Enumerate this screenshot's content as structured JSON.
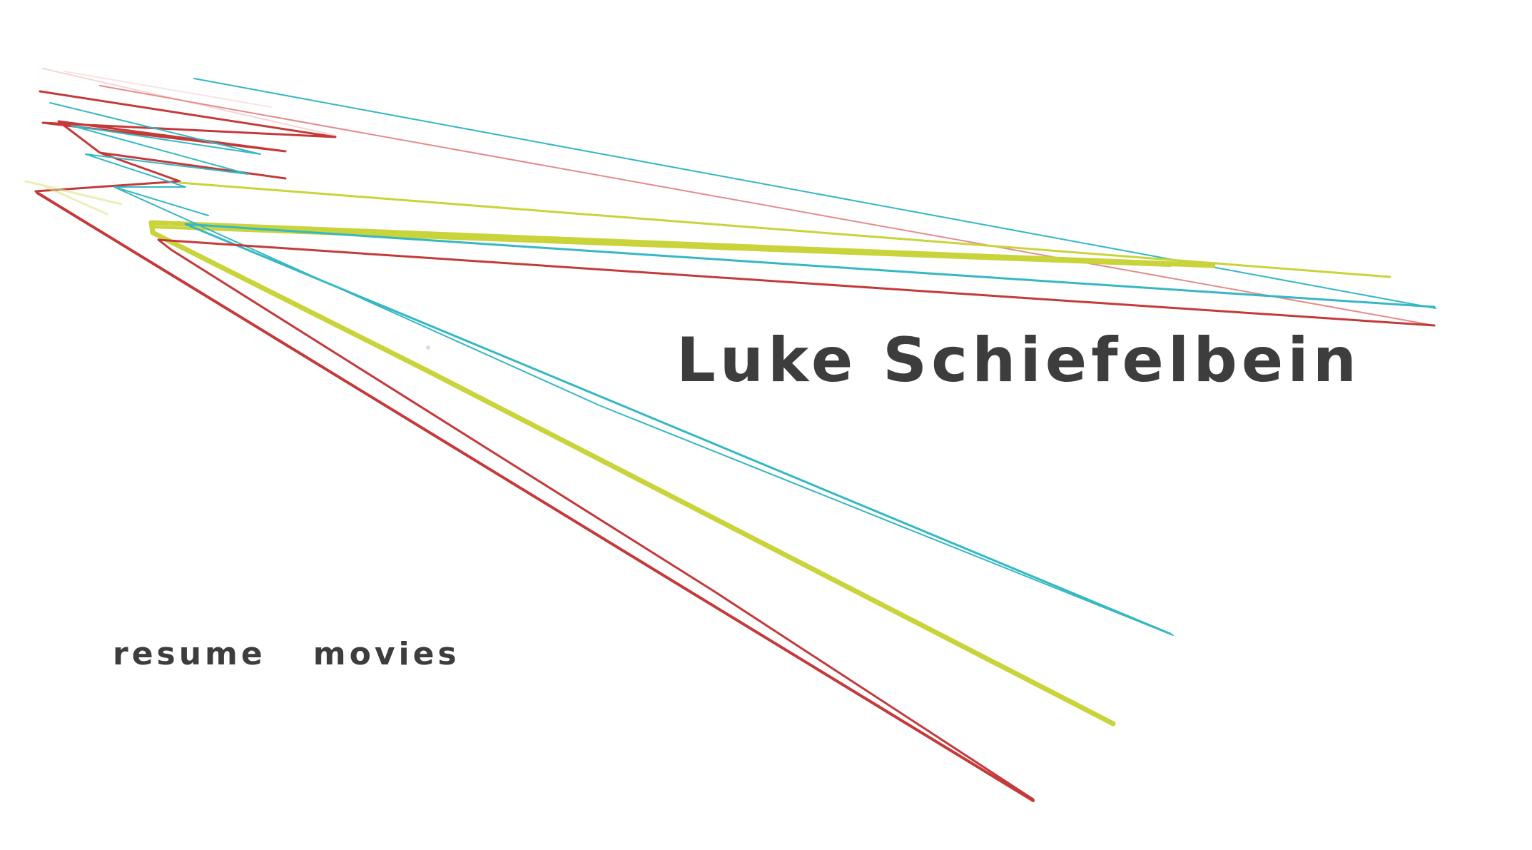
{
  "header": {
    "title": "Luke Schiefelbein"
  },
  "nav": {
    "items": [
      {
        "label": "resume"
      },
      {
        "label": "movies"
      }
    ]
  },
  "colors": {
    "background": "#ffffff",
    "text": "#3d3d3d",
    "line_red": "#c43a3a",
    "line_cyan": "#35b8c4",
    "line_yellow": "#c8d43a",
    "line_pink": "#e89a9a"
  }
}
